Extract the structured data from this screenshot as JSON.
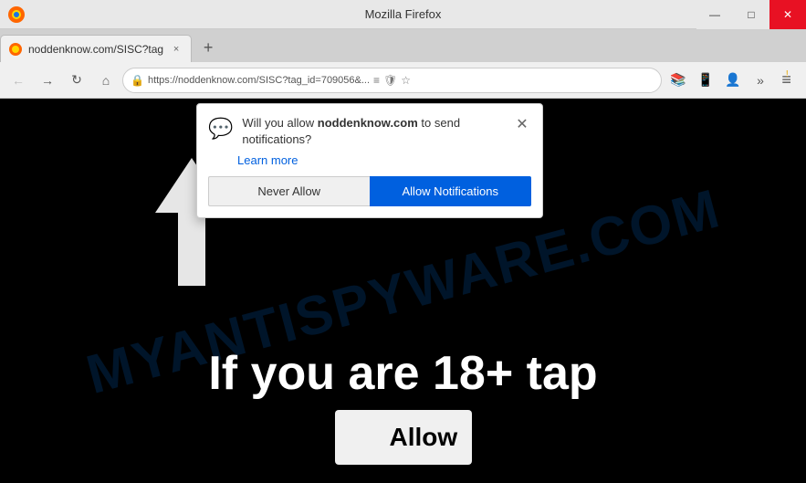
{
  "browser": {
    "title": "Mozilla Firefox",
    "tab": {
      "label": "noddenknow.com/SISC?tag",
      "close_label": "×"
    },
    "new_tab_label": "+",
    "address": "https://noddenknow.com/SISC?tag_id=709056&...",
    "address_ellipsis": "…"
  },
  "nav": {
    "back_label": "←",
    "forward_label": "→",
    "reload_label": "↻",
    "home_label": "⌂",
    "library_label": "📚",
    "bookmarks_label": "☆",
    "sidebars_label": "◫",
    "menu_label": "≡"
  },
  "window_controls": {
    "minimize": "—",
    "maximize": "□",
    "close": "✕"
  },
  "popup": {
    "icon": "💬",
    "close_label": "✕",
    "message_prefix": "Will you allow ",
    "domain": "noddenknow.com",
    "message_suffix": " to send notifications?",
    "learn_more": "Learn more",
    "never_allow_label": "Never Allow",
    "allow_label": "Allow Notifications"
  },
  "page": {
    "watermark": "MYANTISPYWARE.COM",
    "main_text": "If you are 18+ tap",
    "allow_button": "Allow"
  }
}
